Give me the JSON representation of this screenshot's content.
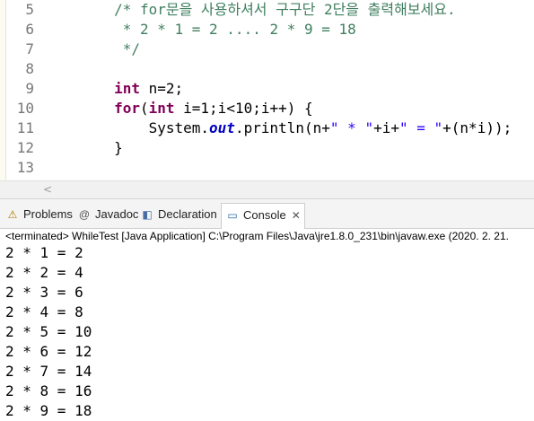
{
  "editor": {
    "lines": [
      {
        "num": "5",
        "segments": [
          {
            "t": "        ",
            "c": ""
          },
          {
            "t": "/* for문을 사용하셔서 구구단 2단을 출력해보세요.",
            "c": "cm"
          }
        ]
      },
      {
        "num": "6",
        "segments": [
          {
            "t": "         ",
            "c": ""
          },
          {
            "t": "* 2 * 1 = 2 .... 2 * 9 = 18",
            "c": "cm"
          }
        ]
      },
      {
        "num": "7",
        "segments": [
          {
            "t": "         ",
            "c": ""
          },
          {
            "t": "*/",
            "c": "cm"
          }
        ]
      },
      {
        "num": "8",
        "segments": []
      },
      {
        "num": "9",
        "segments": [
          {
            "t": "        ",
            "c": ""
          },
          {
            "t": "int",
            "c": "kw"
          },
          {
            "t": " n=2;",
            "c": ""
          }
        ]
      },
      {
        "num": "10",
        "segments": [
          {
            "t": "        ",
            "c": ""
          },
          {
            "t": "for",
            "c": "kw"
          },
          {
            "t": "(",
            "c": ""
          },
          {
            "t": "int",
            "c": "kw"
          },
          {
            "t": " i=1;i<10;i++) {",
            "c": ""
          }
        ]
      },
      {
        "num": "11",
        "segments": [
          {
            "t": "            System.",
            "c": ""
          },
          {
            "t": "out",
            "c": "fld"
          },
          {
            "t": ".println(n+",
            "c": ""
          },
          {
            "t": "\" * \"",
            "c": "str"
          },
          {
            "t": "+i+",
            "c": ""
          },
          {
            "t": "\" = \"",
            "c": "str"
          },
          {
            "t": "+(n*i));",
            "c": ""
          }
        ]
      },
      {
        "num": "12",
        "segments": [
          {
            "t": "        }",
            "c": ""
          }
        ]
      },
      {
        "num": "13",
        "segments": []
      }
    ]
  },
  "scroll": {
    "left_arrow": "<"
  },
  "tabs": [
    {
      "label": "Problems",
      "icon": "problems-icon",
      "glyph": "⚠"
    },
    {
      "label": "Javadoc",
      "icon": "javadoc-icon",
      "glyph": "@"
    },
    {
      "label": "Declaration",
      "icon": "declaration-icon",
      "glyph": "◧"
    },
    {
      "label": "Console",
      "icon": "console-icon",
      "glyph": "▭",
      "close": "✕"
    }
  ],
  "console": {
    "status": "<terminated> WhileTest [Java Application] C:\\Program Files\\Java\\jre1.8.0_231\\bin\\javaw.exe (2020. 2. 21.",
    "output": [
      "2 * 1 = 2",
      "2 * 2 = 4",
      "2 * 3 = 6",
      "2 * 4 = 8",
      "2 * 5 = 10",
      "2 * 6 = 12",
      "2 * 7 = 14",
      "2 * 8 = 16",
      "2 * 9 = 18"
    ]
  }
}
